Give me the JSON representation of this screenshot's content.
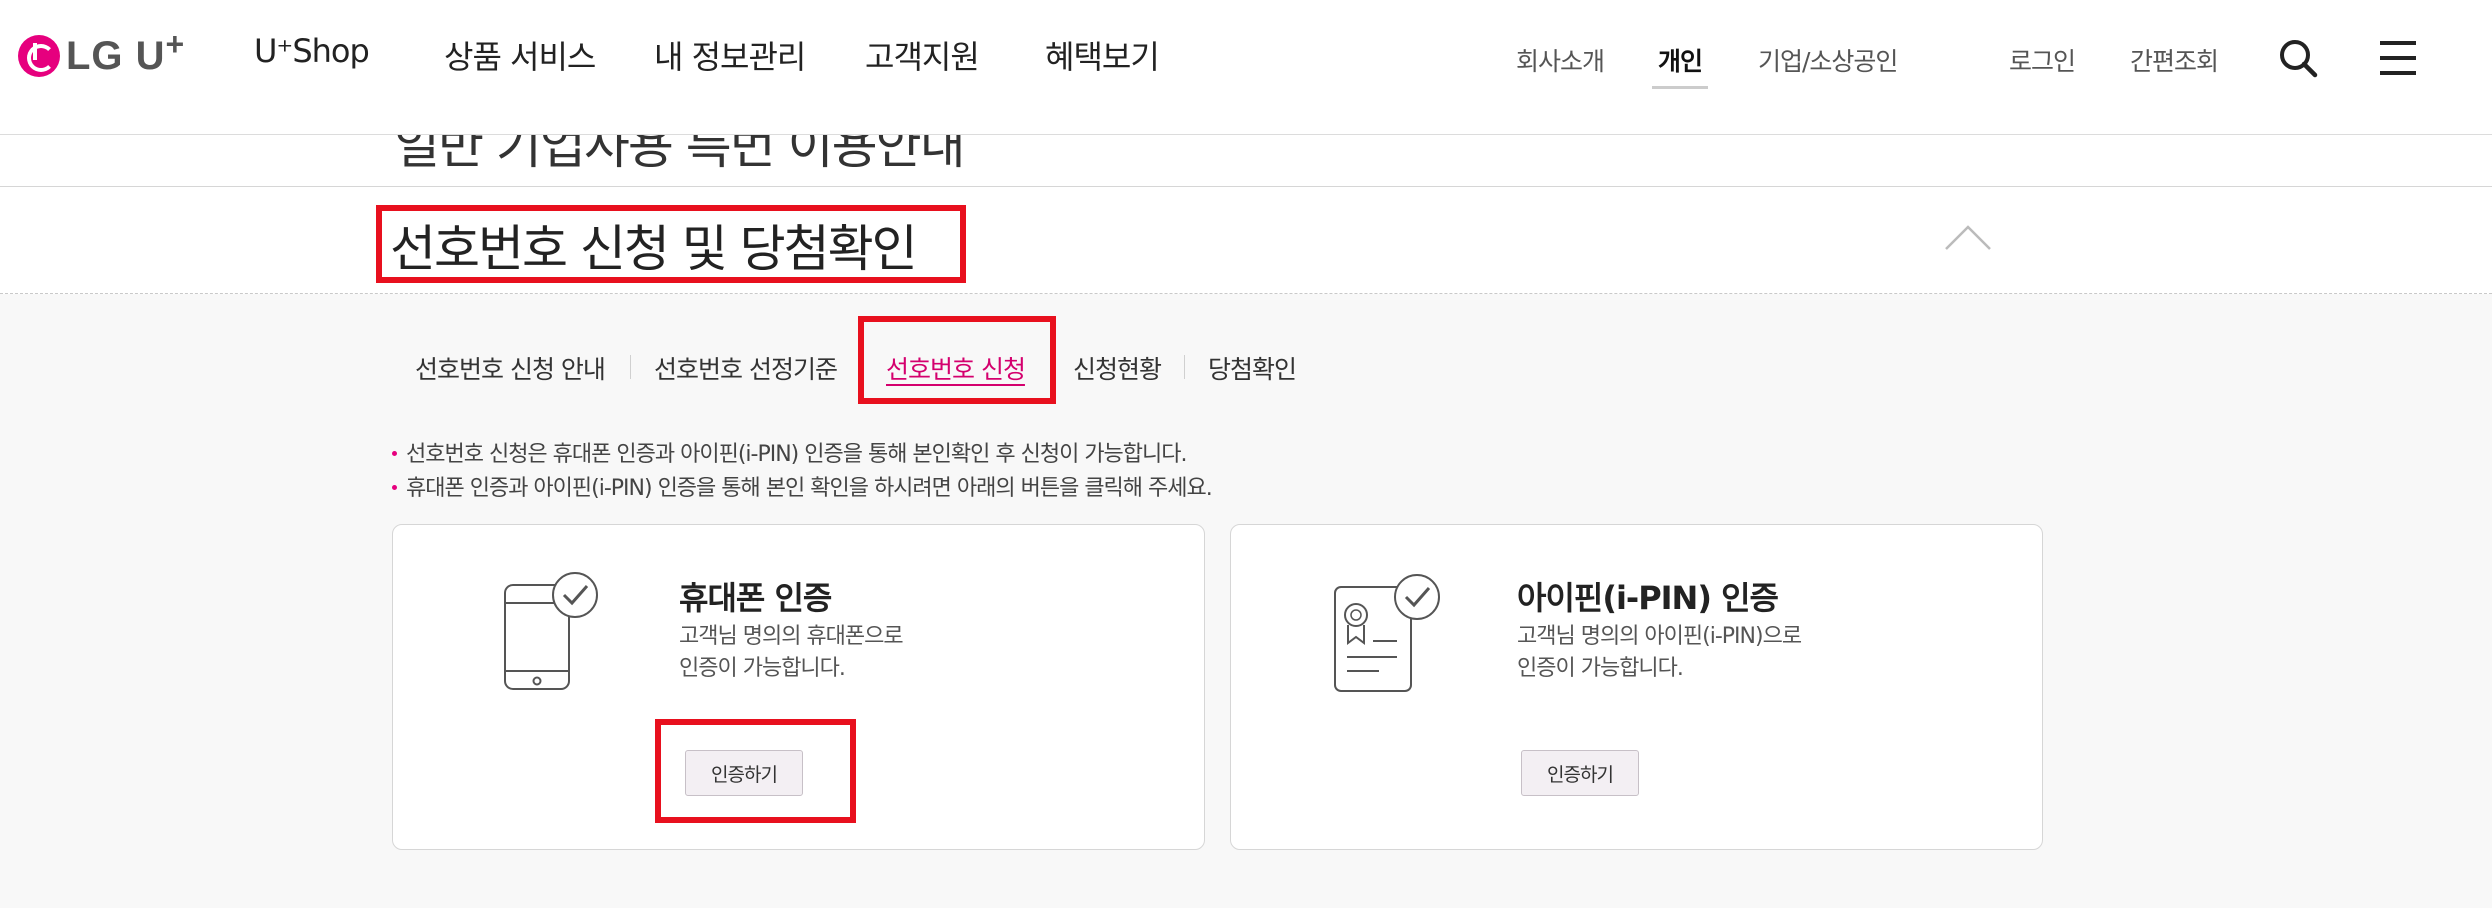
{
  "header": {
    "logo_text": "LG U",
    "logo_plus": "+",
    "nav": [
      "U⁺Shop",
      "상품 서비스",
      "내 정보관리",
      "고객지원",
      "혜택보기"
    ],
    "util": [
      "회사소개",
      "개인",
      "기업/소상공인"
    ],
    "util_active": "개인",
    "login": "로그인",
    "quick_lookup": "간편조회",
    "icons": {
      "search": "search-icon",
      "menu": "hamburger-menu-icon"
    }
  },
  "accordion": {
    "prev_title": "일반 기업사용 특번 이용안내",
    "current_title": "선호번호 신청 및 당첨확인",
    "icons": {
      "prev": "chevron-down-icon",
      "current": "chevron-up-icon"
    }
  },
  "tabs": {
    "items": [
      "선호번호 신청 안내",
      "선호번호 선정기준",
      "선호번호 신청",
      "신청현황",
      "당첨확인"
    ],
    "active": "선호번호 신청"
  },
  "notices": [
    "선호번호 신청은 휴대폰 인증과 아이핀(i-PIN) 인증을 통해 본인확인 후 신청이 가능합니다.",
    "휴대폰 인증과 아이핀(i-PIN) 인증을 통해 본인 확인을 하시려면 아래의 버튼을 클릭해 주세요."
  ],
  "cards": [
    {
      "title": "휴대폰 인증",
      "desc_line1": "고객님 명의의 휴대폰으로",
      "desc_line2": "인증이 가능합니다.",
      "button": "인증하기",
      "icon": "phone-check-icon"
    },
    {
      "title": "아이핀(i-PIN) 인증",
      "desc_line1": "고객님 명의의 아이핀(i-PIN)으로",
      "desc_line2": "인증이 가능합니다.",
      "button": "인증하기",
      "icon": "certificate-check-icon"
    }
  ],
  "colors": {
    "brand": "#e6007e",
    "highlight": "#e8101e",
    "active_tab": "#d4006e"
  }
}
